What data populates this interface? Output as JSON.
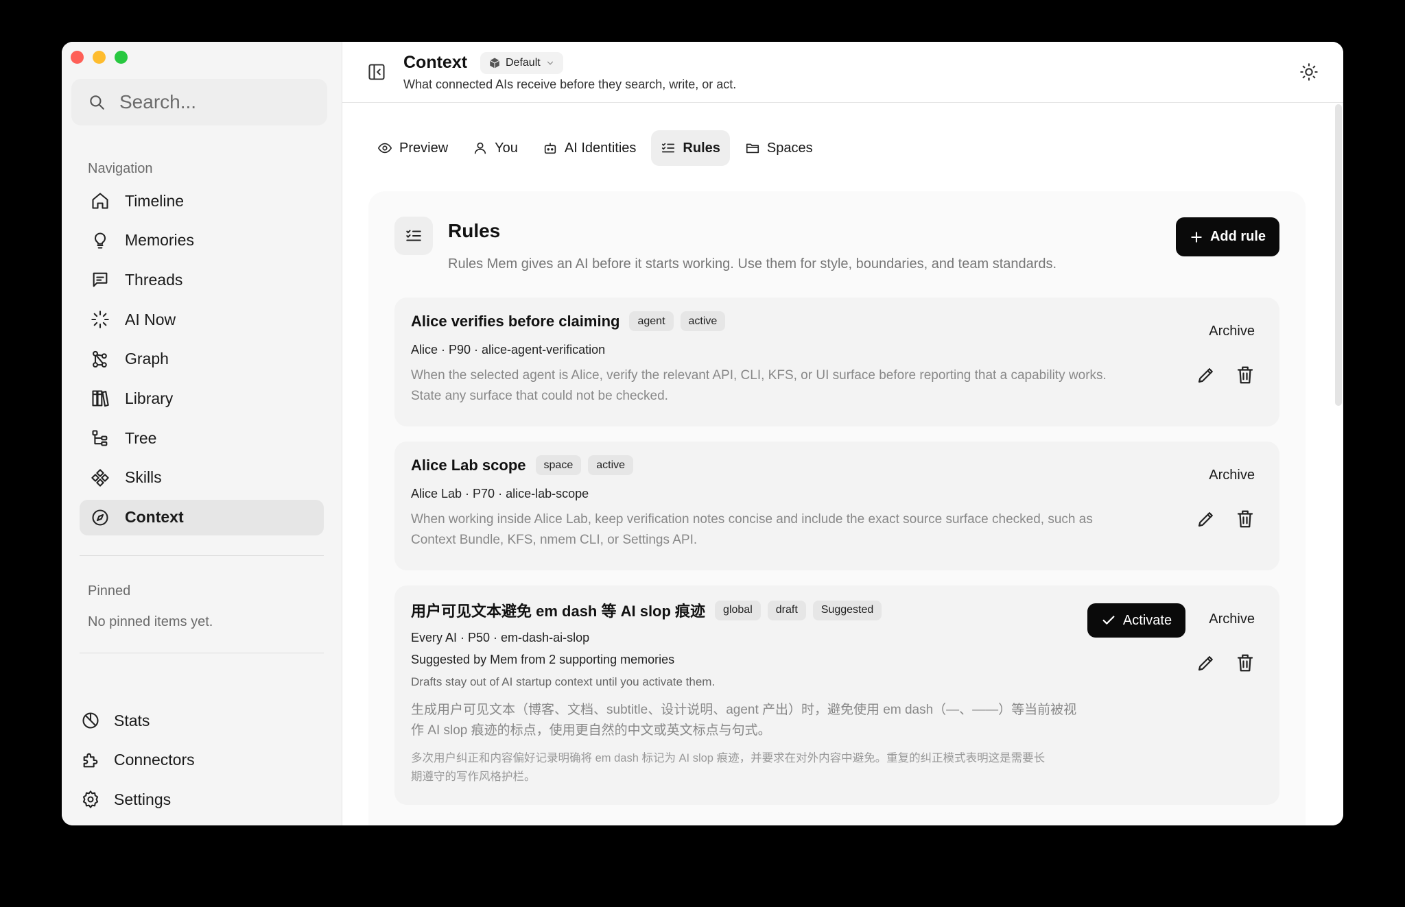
{
  "sidebar": {
    "search_placeholder": "Search...",
    "navigation_label": "Navigation",
    "nav_items": [
      {
        "label": "Timeline",
        "icon": "home-icon"
      },
      {
        "label": "Memories",
        "icon": "lightbulb-icon"
      },
      {
        "label": "Threads",
        "icon": "message-icon"
      },
      {
        "label": "AI Now",
        "icon": "sparkle-loader-icon"
      },
      {
        "label": "Graph",
        "icon": "graph-icon"
      },
      {
        "label": "Library",
        "icon": "library-icon"
      },
      {
        "label": "Tree",
        "icon": "tree-icon"
      },
      {
        "label": "Skills",
        "icon": "skills-icon"
      },
      {
        "label": "Context",
        "icon": "compass-icon",
        "active": true
      }
    ],
    "pinned_label": "Pinned",
    "pinned_empty": "No pinned items yet.",
    "bottom_items": [
      {
        "label": "Stats",
        "icon": "pie-chart-icon"
      },
      {
        "label": "Connectors",
        "icon": "puzzle-icon"
      },
      {
        "label": "Settings",
        "icon": "gear-icon"
      }
    ]
  },
  "header": {
    "title": "Context",
    "context_pill": "Default",
    "subtitle": "What connected AIs receive before they search, write, or act."
  },
  "tabs": [
    {
      "label": "Preview",
      "icon": "eye-icon"
    },
    {
      "label": "You",
      "icon": "user-icon"
    },
    {
      "label": "AI Identities",
      "icon": "bot-icon"
    },
    {
      "label": "Rules",
      "icon": "list-check-icon",
      "active": true
    },
    {
      "label": "Spaces",
      "icon": "folder-icon"
    }
  ],
  "rules_panel": {
    "title": "Rules",
    "subtitle": "Rules Mem gives an AI before it starts working. Use them for style, boundaries, and team standards.",
    "add_button": "Add rule"
  },
  "rules": [
    {
      "title": "Alice verifies before claiming",
      "tags": [
        "agent",
        "active"
      ],
      "meta": "Alice · P90 · alice-agent-verification",
      "description_line1": "When the selected agent is Alice, verify the relevant API, CLI, KFS, or UI surface before reporting that a capability works.",
      "description_line2": "State any surface that could not be checked.",
      "archive": "Archive"
    },
    {
      "title": "Alice Lab scope",
      "tags": [
        "space",
        "active"
      ],
      "meta": "Alice Lab · P70 · alice-lab-scope",
      "description_line1": "When working inside Alice Lab, keep verification notes concise and include the exact source surface checked, such as",
      "description_line2": "Context Bundle, KFS, nmem CLI, or Settings API.",
      "archive": "Archive"
    },
    {
      "title": "用户可见文本避免 em dash 等 AI slop 痕迹",
      "tags": [
        "global",
        "draft",
        "Suggested"
      ],
      "meta": "Every AI · P50 · em-dash-ai-slop",
      "suggested_by": "Suggested by Mem from 2 supporting memories",
      "draft_note": "Drafts stay out of AI startup context until you activate them.",
      "description_line1": "生成用户可见文本（博客、文档、subtitle、设计说明、agent 产出）时，避免使用 em dash（—、——）等当前被视",
      "description_line2": "作 AI slop 痕迹的标点，使用更自然的中文或英文标点与句式。",
      "evidence_line1": "多次用户纠正和内容偏好记录明确将 em dash 标记为 AI slop 痕迹，并要求在对外内容中避免。重复的纠正模式表明这是需要长",
      "evidence_line2": "期遵守的写作风格护栏。",
      "activate": "Activate",
      "archive": "Archive"
    }
  ]
}
